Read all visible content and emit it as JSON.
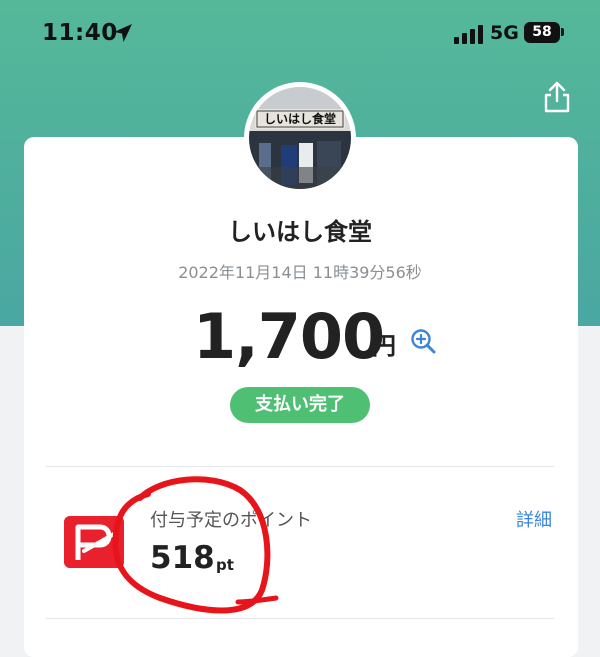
{
  "status_bar": {
    "time": "11:40",
    "network": "5G",
    "battery": "58"
  },
  "receipt": {
    "store_name": "しいはし食堂",
    "timestamp": "2022年11月14日 11時39分56秒",
    "amount": "1,700",
    "currency": "円",
    "status": "支払い完了"
  },
  "points": {
    "label": "付与予定のポイント",
    "value": "518",
    "unit": "pt",
    "details_link": "詳細"
  },
  "icons": {
    "location": "location-arrow-icon",
    "signal": "signal-bars-icon",
    "battery": "battery-icon",
    "share": "share-icon",
    "zoom": "zoom-in-icon",
    "paypay": "paypay-logo-icon"
  },
  "colors": {
    "header_top": "#55b899",
    "header_bottom": "#4aa7a2",
    "status_badge": "#4fbf74",
    "link": "#3b86d8",
    "paypay_red": "#e8212d",
    "annotation_red": "#e8141c"
  }
}
